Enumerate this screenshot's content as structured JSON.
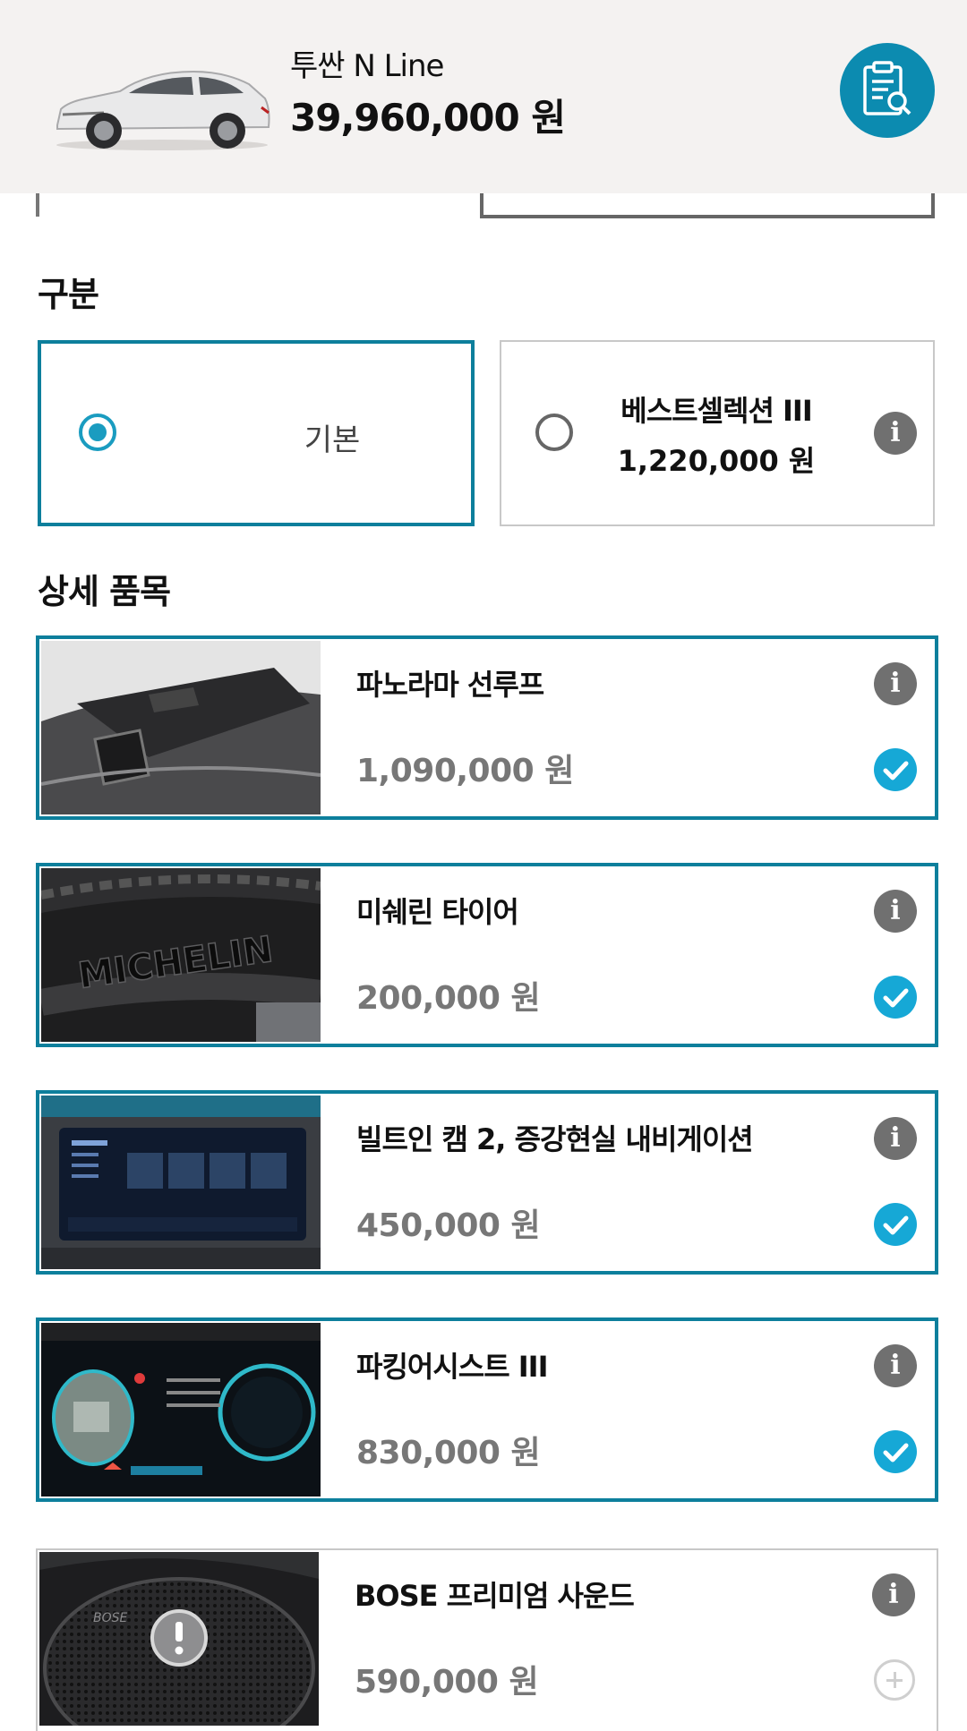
{
  "header": {
    "model_name": "투싼 N Line",
    "total_price": "39,960,000 원",
    "summary_icon": "clipboard-search-icon"
  },
  "category": {
    "title": "구분",
    "options": [
      {
        "label": "기본",
        "selected": true
      },
      {
        "name": "베스트셀렉션 III",
        "price": "1,220,000 원",
        "selected": false
      }
    ]
  },
  "details": {
    "title": "상세 품목",
    "items": [
      {
        "name": "파노라마 선루프",
        "price": "1,090,000 원",
        "selected": true,
        "image": "panorama-sunroof-photo"
      },
      {
        "name": "미쉐린 타이어",
        "price": "200,000 원",
        "selected": true,
        "image": "michelin-tire-photo"
      },
      {
        "name": "빌트인 캠 2, 증강현실 내비게이션",
        "price": "450,000 원",
        "selected": true,
        "image": "navigation-screen-photo"
      },
      {
        "name": "파킹어시스트 III",
        "price": "830,000 원",
        "selected": true,
        "image": "cluster-display-photo"
      },
      {
        "name": "BOSE 프리미엄 사운드",
        "price": "590,000 원",
        "selected": false,
        "image": "bose-speaker-photo"
      }
    ]
  },
  "colors": {
    "accent": "#0d7f9c",
    "check": "#16a8d6",
    "summary_button": "#0c8bb0",
    "header_bg": "#f4f2f1"
  }
}
